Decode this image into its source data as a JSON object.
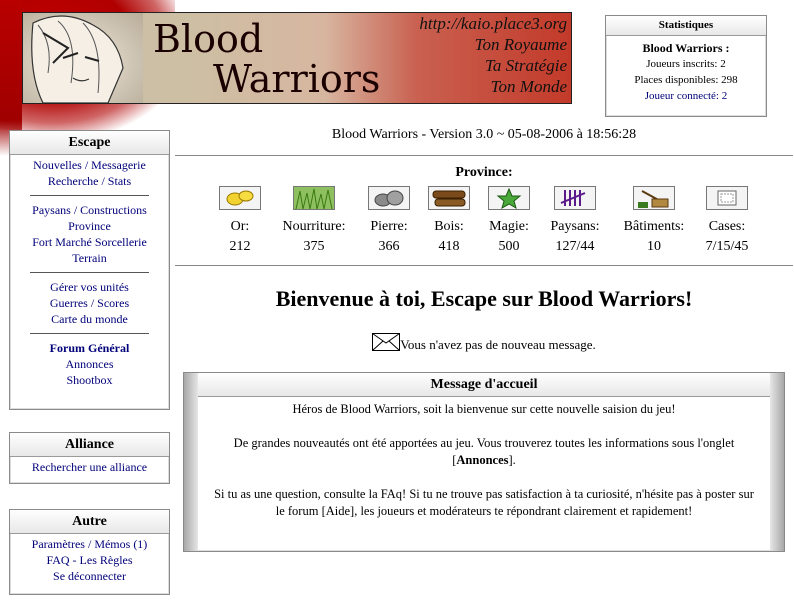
{
  "banner": {
    "logo_line1": "Blood",
    "logo_line2": "Warriors",
    "url": "http://kaio.place3.org",
    "slogan1": "Ton Royaume",
    "slogan2": "Ta Stratégie",
    "slogan3": "Ton Monde"
  },
  "stats": {
    "header": "Statistiques",
    "game": "Blood Warriors :",
    "joueurs_inscrits": "Joueurs inscrits: 2",
    "places": "Places disponibles: 298",
    "connecte": "Joueur connecté: 2"
  },
  "menu_escape": {
    "header": "Escape",
    "g1": [
      "Nouvelles / Messagerie",
      "Recherche / Stats"
    ],
    "g2": [
      "Paysans / Constructions",
      "Province",
      "Fort Marché Sorcellerie",
      "Terrain"
    ],
    "g3": [
      "Gérer vos unités",
      "Guerres / Scores",
      "Carte du monde"
    ],
    "g4": [
      "Forum Général",
      "Annonces",
      "Shootbox"
    ]
  },
  "menu_alliance": {
    "header": "Alliance",
    "items": [
      "Rechercher une alliance"
    ]
  },
  "menu_autre": {
    "header": "Autre",
    "items": [
      "Paramètres / Mémos (1)",
      "FAQ - Les Règles",
      "Se déconnecter"
    ]
  },
  "main": {
    "version": "Blood Warriors - Version 3.0 ~ 05-08-2006 à 18:56:28",
    "province_title": "Province:",
    "resources": [
      {
        "icon": "gold-icon",
        "label": "Or:",
        "value": "212"
      },
      {
        "icon": "grass-icon",
        "label": "Nourriture:",
        "value": "375"
      },
      {
        "icon": "stone-icon",
        "label": "Pierre:",
        "value": "366"
      },
      {
        "icon": "wood-icon",
        "label": "Bois:",
        "value": "418"
      },
      {
        "icon": "magic-star-icon",
        "label": "Magie:",
        "value": "500"
      },
      {
        "icon": "tally-icon",
        "label": "Paysans:",
        "value": "127/44"
      },
      {
        "icon": "building-icon",
        "label": "Bâtiments:",
        "value": "10"
      },
      {
        "icon": "tile-icon",
        "label": "Cases:",
        "value": "7/15/45"
      }
    ],
    "welcome": "Bienvenue à toi, Escape sur Blood Warriors!",
    "no_message": "Vous n'avez pas de nouveau message.",
    "accueil": {
      "header": "Message d'accueil",
      "p1": "Héros de Blood Warriors, soit la bienvenue sur cette nouvelle saision du jeu!",
      "p2a": "De grandes nouveautés ont été apportées au jeu. Vous trouverez toutes les informations sous l'onglet [",
      "p2b": "Annonces",
      "p2c": "].",
      "p3": "Si tu as une question, consulte la FAq! Si tu ne trouve pas satisfaction à ta curiosité, n'hésite pas à poster sur le forum [Aide], les joueurs et modérateurs te répondrant clairement et rapidement!"
    }
  }
}
